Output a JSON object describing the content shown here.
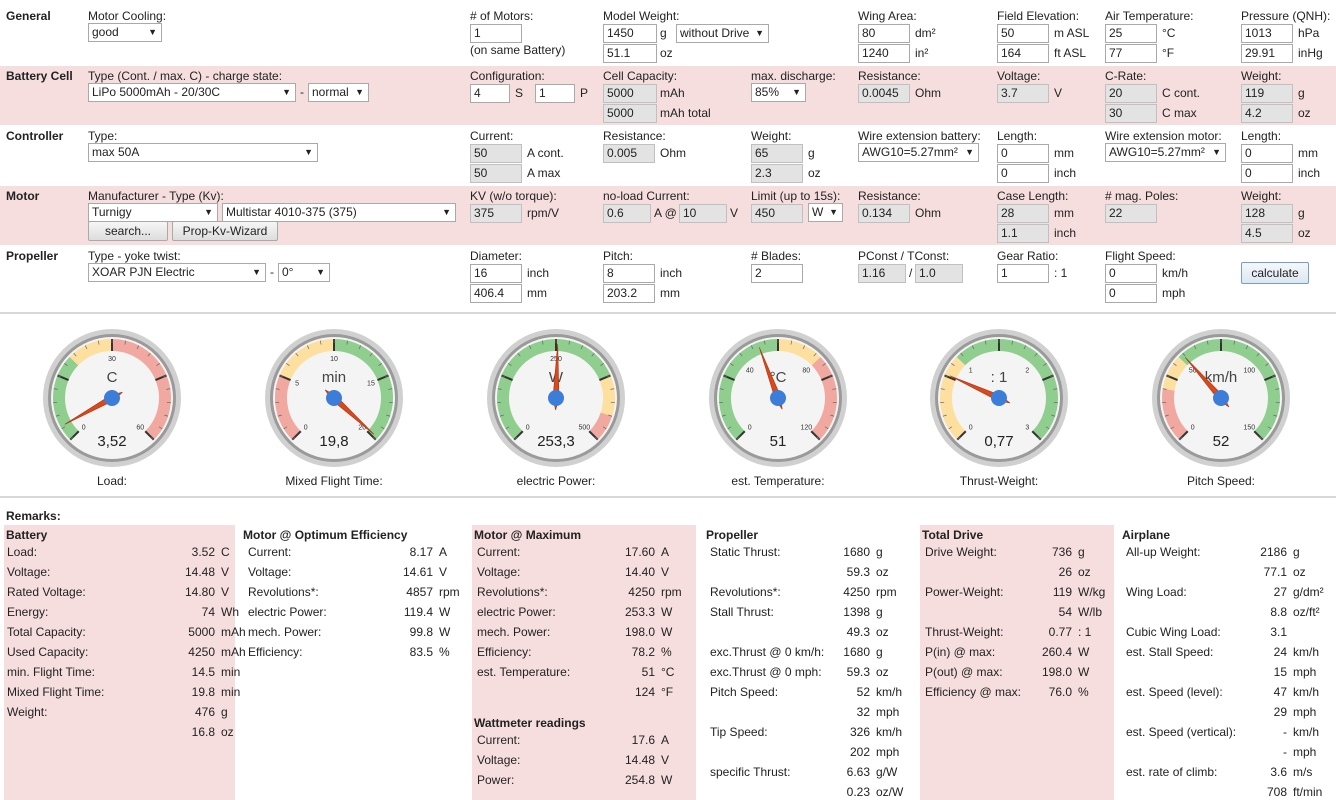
{
  "general": {
    "title": "General",
    "motor_cooling_label": "Motor Cooling:",
    "motor_cooling": "good",
    "num_motors_label": "# of Motors:",
    "num_motors": "1",
    "num_motors_note": "(on same Battery)",
    "model_weight_label": "Model Weight:",
    "model_weight_g": "1450",
    "model_weight_oz": "51.1",
    "unit_g": "g",
    "unit_oz": "oz",
    "weight_mode": "without Drive",
    "wing_area_label": "Wing Area:",
    "wing_area_dm": "80",
    "wing_area_in": "1240",
    "unit_dm2": "dm²",
    "unit_in2": "in²",
    "field_elev_label": "Field Elevation:",
    "field_elev_m": "50",
    "field_elev_ft": "164",
    "unit_masl": "m ASL",
    "unit_ftasl": "ft ASL",
    "air_temp_label": "Air Temperature:",
    "air_temp_c": "25",
    "air_temp_f": "77",
    "unit_c": "°C",
    "unit_f": "°F",
    "pressure_label": "Pressure (QNH):",
    "pressure_hpa": "1013",
    "pressure_inhg": "29.91",
    "unit_hpa": "hPa",
    "unit_inhg": "inHg"
  },
  "battery": {
    "title": "Battery Cell",
    "type_label": "Type (Cont. / max. C) - charge state:",
    "type": "LiPo 5000mAh - 20/30C",
    "dash": "-",
    "charge": "normal",
    "config_label": "Configuration:",
    "s": "4",
    "s_unit": "S",
    "p": "1",
    "p_unit": "P",
    "capacity_label": "Cell Capacity:",
    "capacity": "5000",
    "capacity_total": "5000",
    "unit_mah": "mAh",
    "unit_mah_total": "mAh total",
    "max_discharge_label": "max. discharge:",
    "max_discharge": "85%",
    "resistance_label": "Resistance:",
    "resistance": "0.0045",
    "unit_ohm": "Ohm",
    "voltage_label": "Voltage:",
    "voltage": "3.7",
    "unit_v": "V",
    "crate_label": "C-Rate:",
    "c_cont": "20",
    "c_max": "30",
    "unit_ccont": "C cont.",
    "unit_cmax": "C max",
    "weight_label": "Weight:",
    "weight_g": "119",
    "weight_oz": "4.2",
    "unit_g": "g",
    "unit_oz": "oz"
  },
  "controller": {
    "title": "Controller",
    "type_label": "Type:",
    "type": "max 50A",
    "current_label": "Current:",
    "current_cont": "50",
    "current_max": "50",
    "unit_acont": "A cont.",
    "unit_amax": "A max",
    "resistance_label": "Resistance:",
    "resistance": "0.005",
    "unit_ohm": "Ohm",
    "weight_label": "Weight:",
    "weight_g": "65",
    "weight_oz": "2.3",
    "unit_g": "g",
    "unit_oz": "oz",
    "wire_batt_label": "Wire extension battery:",
    "wire_batt": "AWG10=5.27mm²",
    "length_label": "Length:",
    "len_batt_mm": "0",
    "len_batt_inch": "0",
    "unit_mm": "mm",
    "unit_inch": "inch",
    "wire_motor_label": "Wire extension motor:",
    "wire_motor": "AWG10=5.27mm²",
    "len_motor_mm": "0",
    "len_motor_inch": "0"
  },
  "motor": {
    "title": "Motor",
    "manuf_label": "Manufacturer - Type (Kv):",
    "manufacturer": "Turnigy",
    "type": "Multistar 4010-375 (375)",
    "search_btn": "search...",
    "wizard_btn": "Prop-Kv-Wizard",
    "kv_label": "KV (w/o torque):",
    "kv": "375",
    "unit_rpmv": "rpm/V",
    "noload_label": "no-load Current:",
    "noload_a": "0.6",
    "noload_at": "A @",
    "noload_v": "10",
    "unit_v": "V",
    "limit_label": "Limit (up to 15s):",
    "limit": "450",
    "limit_unit": "W",
    "resistance_label": "Resistance:",
    "resistance": "0.134",
    "unit_ohm": "Ohm",
    "case_label": "Case Length:",
    "case_mm": "28",
    "case_inch": "1.1",
    "unit_mm": "mm",
    "unit_inch": "inch",
    "poles_label": "# mag. Poles:",
    "poles": "22",
    "weight_label": "Weight:",
    "weight_g": "128",
    "weight_oz": "4.5",
    "unit_g": "g",
    "unit_oz": "oz"
  },
  "propeller": {
    "title": "Propeller",
    "type_label": "Type - yoke twist:",
    "type": "XOAR PJN Electric",
    "dash": "-",
    "twist": "0°",
    "diameter_label": "Diameter:",
    "diameter_inch": "16",
    "diameter_mm": "406.4",
    "unit_inch": "inch",
    "unit_mm": "mm",
    "pitch_label": "Pitch:",
    "pitch_inch": "8",
    "pitch_mm": "203.2",
    "blades_label": "# Blades:",
    "blades": "2",
    "pconst_label": "PConst / TConst:",
    "pconst": "1.16",
    "slash": "/",
    "tconst": "1.0",
    "gear_label": "Gear Ratio:",
    "gear": "1",
    "gear_unit": ": 1",
    "speed_label": "Flight Speed:",
    "speed_kmh": "0",
    "speed_mph": "0",
    "unit_kmh": "km/h",
    "unit_mph": "mph",
    "calculate_btn": "calculate"
  },
  "gauges": [
    {
      "label": "Load:",
      "unit": "C",
      "value": "3,52",
      "min": "0",
      "max": "60",
      "mid": "30",
      "reading": 3.52
    },
    {
      "label": "Mixed Flight Time:",
      "unit": "min",
      "value": "19,8",
      "min": "0",
      "max": "20",
      "t1": "5",
      "t2": "10",
      "t3": "15",
      "reading": 19.8
    },
    {
      "label": "electric Power:",
      "unit": "W",
      "value": "253,3",
      "min": "0",
      "max": "500",
      "mid": "250",
      "reading": 253.3
    },
    {
      "label": "est. Temperature:",
      "unit": "°C",
      "value": "51",
      "min": "0",
      "max": "120",
      "t1": "40",
      "t2": "80",
      "reading": 51
    },
    {
      "label": "Thrust-Weight:",
      "unit": ": 1",
      "value": "0,77",
      "min": "0",
      "max": "3",
      "t1": "1",
      "t2": "2",
      "reading": 0.77
    },
    {
      "label": "Pitch Speed:",
      "unit": "km/h",
      "value": "52",
      "min": "0",
      "max": "150",
      "t1": "50",
      "t2": "100",
      "reading": 52
    }
  ],
  "remarks": {
    "title": "Remarks:",
    "battery": {
      "title": "Battery",
      "rows": [
        {
          "l": "Load:",
          "v": "3.52",
          "u": "C"
        },
        {
          "l": "Voltage:",
          "v": "14.48",
          "u": "V"
        },
        {
          "l": "Rated Voltage:",
          "v": "14.80",
          "u": "V"
        },
        {
          "l": "Energy:",
          "v": "74",
          "u": "Wh"
        },
        {
          "l": "Total Capacity:",
          "v": "5000",
          "u": "mAh"
        },
        {
          "l": "Used Capacity:",
          "v": "4250",
          "u": "mAh"
        },
        {
          "l": "min. Flight Time:",
          "v": "14.5",
          "u": "min"
        },
        {
          "l": "Mixed Flight Time:",
          "v": "19.8",
          "u": "min"
        },
        {
          "l": "Weight:",
          "v": "476",
          "u": "g"
        },
        {
          "l": "",
          "v": "16.8",
          "u": "oz"
        }
      ]
    },
    "opt": {
      "title": "Motor @ Optimum Efficiency",
      "rows": [
        {
          "l": "Current:",
          "v": "8.17",
          "u": "A"
        },
        {
          "l": "Voltage:",
          "v": "14.61",
          "u": "V"
        },
        {
          "l": "Revolutions*:",
          "v": "4857",
          "u": "rpm"
        },
        {
          "l": "electric Power:",
          "v": "119.4",
          "u": "W"
        },
        {
          "l": "mech. Power:",
          "v": "99.8",
          "u": "W"
        },
        {
          "l": "Efficiency:",
          "v": "83.5",
          "u": "%"
        }
      ]
    },
    "max": {
      "title": "Motor @ Maximum",
      "rows": [
        {
          "l": "Current:",
          "v": "17.60",
          "u": "A"
        },
        {
          "l": "Voltage:",
          "v": "14.40",
          "u": "V"
        },
        {
          "l": "Revolutions*:",
          "v": "4250",
          "u": "rpm"
        },
        {
          "l": "electric Power:",
          "v": "253.3",
          "u": "W"
        },
        {
          "l": "mech. Power:",
          "v": "198.0",
          "u": "W"
        },
        {
          "l": "Efficiency:",
          "v": "78.2",
          "u": "%"
        },
        {
          "l": "est. Temperature:",
          "v": "51",
          "u": "°C"
        },
        {
          "l": "",
          "v": "124",
          "u": "°F"
        }
      ],
      "watt_title": "Wattmeter readings",
      "watt_rows": [
        {
          "l": "Current:",
          "v": "17.6",
          "u": "A"
        },
        {
          "l": "Voltage:",
          "v": "14.48",
          "u": "V"
        },
        {
          "l": "Power:",
          "v": "254.8",
          "u": "W"
        }
      ]
    },
    "prop": {
      "title": "Propeller",
      "rows": [
        {
          "l": "Static Thrust:",
          "v": "1680",
          "u": "g"
        },
        {
          "l": "",
          "v": "59.3",
          "u": "oz"
        },
        {
          "l": "Revolutions*:",
          "v": "4250",
          "u": "rpm"
        },
        {
          "l": "Stall Thrust:",
          "v": "1398",
          "u": "g"
        },
        {
          "l": "",
          "v": "49.3",
          "u": "oz"
        },
        {
          "l": "exc.Thrust @ 0 km/h:",
          "v": "1680",
          "u": "g"
        },
        {
          "l": "exc.Thrust @ 0 mph:",
          "v": "59.3",
          "u": "oz"
        },
        {
          "l": "Pitch Speed:",
          "v": "52",
          "u": "km/h"
        },
        {
          "l": "",
          "v": "32",
          "u": "mph"
        },
        {
          "l": "Tip Speed:",
          "v": "326",
          "u": "km/h"
        },
        {
          "l": "",
          "v": "202",
          "u": "mph"
        },
        {
          "l": "specific Thrust:",
          "v": "6.63",
          "u": "g/W"
        },
        {
          "l": "",
          "v": "0.23",
          "u": "oz/W"
        }
      ]
    },
    "drive": {
      "title": "Total Drive",
      "rows": [
        {
          "l": "Drive Weight:",
          "v": "736",
          "u": "g"
        },
        {
          "l": "",
          "v": "26",
          "u": "oz"
        },
        {
          "l": "Power-Weight:",
          "v": "119",
          "u": "W/kg"
        },
        {
          "l": "",
          "v": "54",
          "u": "W/lb"
        },
        {
          "l": "Thrust-Weight:",
          "v": "0.77",
          "u": ": 1"
        },
        {
          "l": "P(in) @ max:",
          "v": "260.4",
          "u": "W"
        },
        {
          "l": "P(out) @ max:",
          "v": "198.0",
          "u": "W"
        },
        {
          "l": "Efficiency @ max:",
          "v": "76.0",
          "u": "%"
        }
      ]
    },
    "plane": {
      "title": "Airplane",
      "rows": [
        {
          "l": "All-up Weight:",
          "v": "2186",
          "u": "g"
        },
        {
          "l": "",
          "v": "77.1",
          "u": "oz"
        },
        {
          "l": "Wing Load:",
          "v": "27",
          "u": "g/dm²"
        },
        {
          "l": "",
          "v": "8.8",
          "u": "oz/ft²"
        },
        {
          "l": "Cubic Wing Load:",
          "v": "3.1",
          "u": ""
        },
        {
          "l": "est. Stall Speed:",
          "v": "24",
          "u": "km/h"
        },
        {
          "l": "",
          "v": "15",
          "u": "mph"
        },
        {
          "l": "est. Speed (level):",
          "v": "47",
          "u": "km/h"
        },
        {
          "l": "",
          "v": "29",
          "u": "mph"
        },
        {
          "l": "est. Speed (vertical):",
          "v": "-",
          "u": "km/h"
        },
        {
          "l": "",
          "v": "-",
          "u": "mph"
        },
        {
          "l": "est. rate of climb:",
          "v": "3.6",
          "u": "m/s"
        },
        {
          "l": "",
          "v": "708",
          "u": "ft/min"
        }
      ]
    }
  }
}
